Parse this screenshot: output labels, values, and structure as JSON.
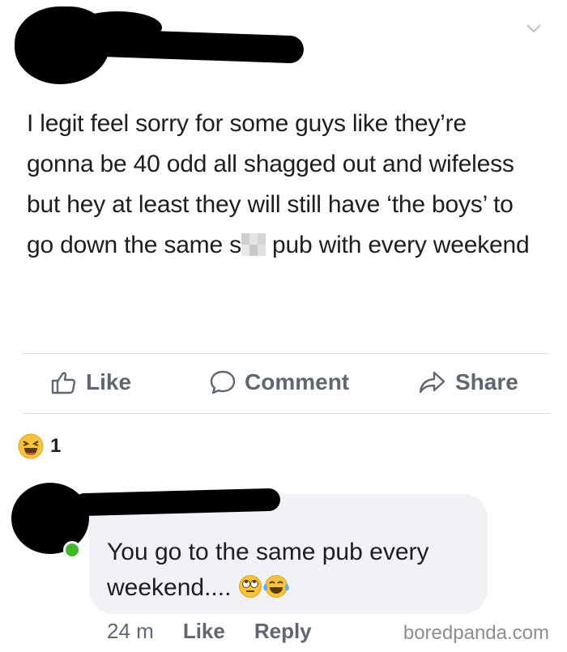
{
  "post": {
    "text_before": "I legit feel sorry for some guys like they’re gonna be 40 odd all shagged out and wifeless but hey at least they will still have ‘the boys’ to go down the same s",
    "text_after": " pub with every weekend",
    "menu_icon": "chevron-down-icon"
  },
  "actions": {
    "like_label": "Like",
    "comment_label": "Comment",
    "share_label": "Share"
  },
  "reactions": {
    "icon": "laughing-emoji-icon",
    "count": "1"
  },
  "comment": {
    "text": "You go to the same pub every weekend....",
    "emojis": [
      "eye-roll-emoji-icon",
      "tears-of-joy-emoji-icon"
    ],
    "time": "24 m",
    "like_label": "Like",
    "reply_label": "Reply"
  },
  "watermark": "boredpanda.com",
  "colors": {
    "text": "#1c1e21",
    "secondary": "#606770",
    "bubble": "#f0f2f5",
    "online": "#42b72a"
  }
}
